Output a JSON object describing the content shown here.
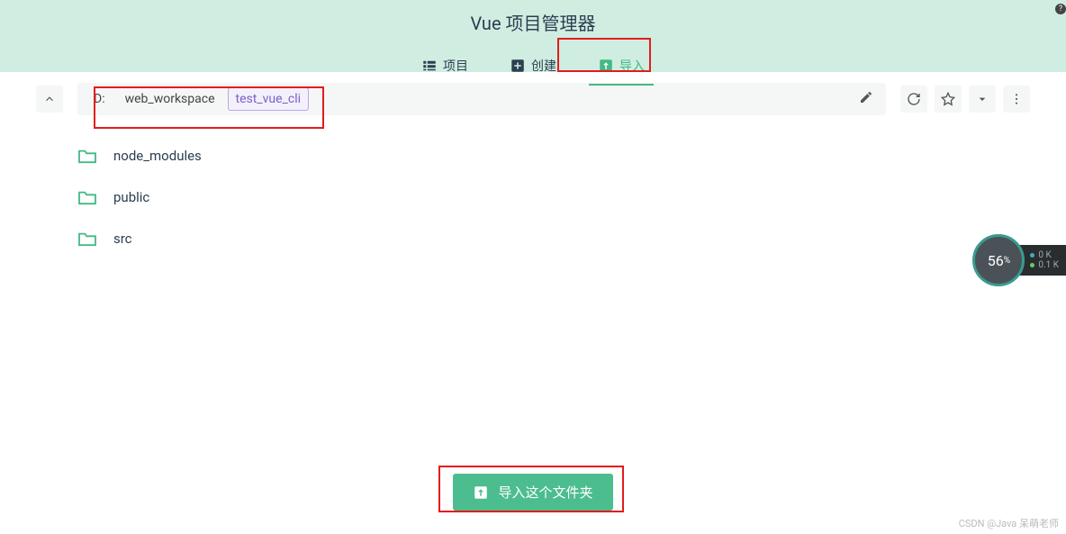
{
  "header": {
    "title": "Vue 项目管理器",
    "tabs": [
      {
        "id": "projects",
        "label": "项目",
        "icon": "list-icon",
        "active": false
      },
      {
        "id": "create",
        "label": "创建",
        "icon": "plus-box-icon",
        "active": false
      },
      {
        "id": "import",
        "label": "导入",
        "icon": "import-box-icon",
        "active": true
      }
    ]
  },
  "path": {
    "segments": [
      {
        "label": "D:",
        "active": false
      },
      {
        "label": "web_workspace",
        "active": false
      },
      {
        "label": "test_vue_cli",
        "active": true
      }
    ]
  },
  "toolbar": {
    "edit": "edit",
    "refresh": "refresh",
    "favorite": "favorite",
    "dropdown": "dropdown",
    "more": "more"
  },
  "folders": [
    {
      "name": "node_modules"
    },
    {
      "name": "public"
    },
    {
      "name": "src"
    }
  ],
  "import_button": {
    "label": "导入这个文件夹"
  },
  "perf": {
    "value": "56",
    "unit": "%",
    "up": "0 K",
    "down": "0.1 K"
  },
  "watermark": "CSDN @Java 呆萌老师"
}
